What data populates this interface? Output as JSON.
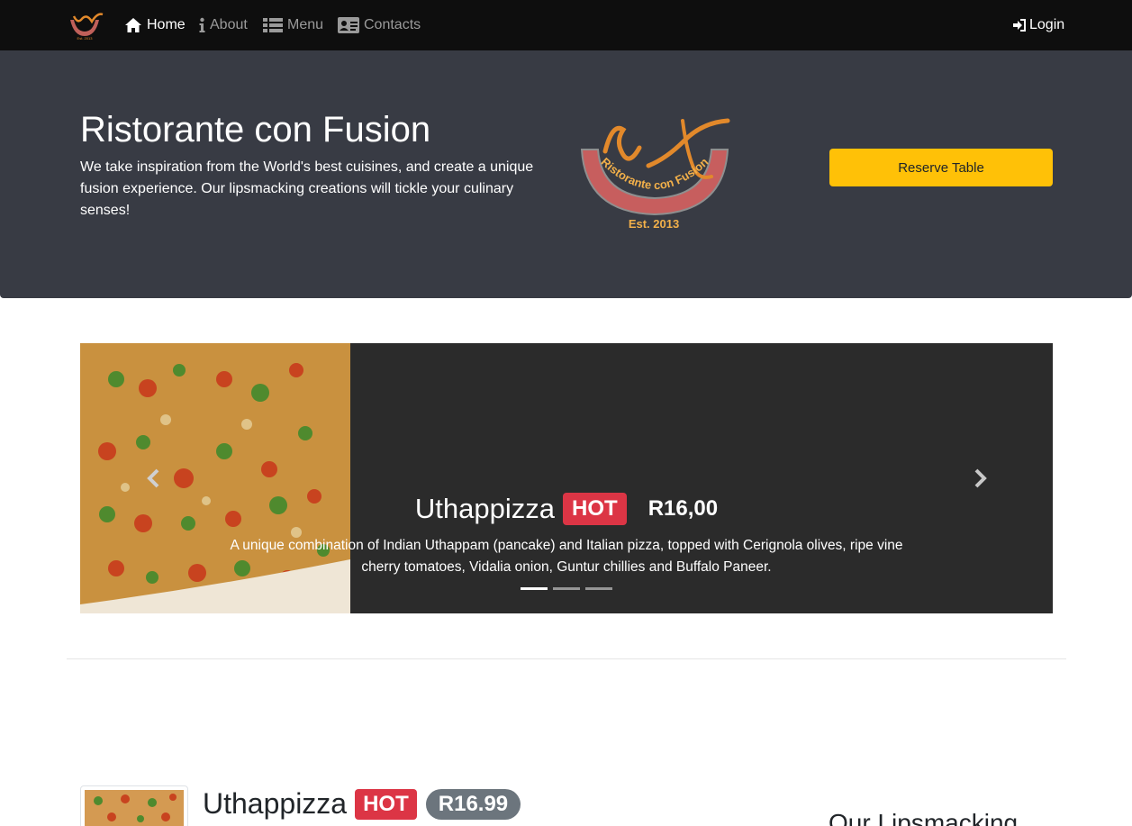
{
  "colors": {
    "navbar_bg": "#0e0e0e",
    "jumbotron_bg": "#383b44",
    "accent_warning": "#ffc107",
    "badge_danger": "#dc3545",
    "badge_secondary": "#6c757d",
    "carousel_bg": "#2b2b2b"
  },
  "navbar": {
    "brand_icon": "restaurant-logo-icon",
    "items": [
      {
        "label": "Home",
        "icon": "home-icon",
        "active": true
      },
      {
        "label": "About",
        "icon": "info-icon",
        "active": false
      },
      {
        "label": "Menu",
        "icon": "list-icon",
        "active": false
      },
      {
        "label": "Contacts",
        "icon": "address-card-icon",
        "active": false
      }
    ],
    "login": {
      "label": "Login",
      "icon": "sign-in-icon"
    }
  },
  "jumbotron": {
    "title": "Ristorante con Fusion",
    "text": "We take inspiration from the World's best cuisines, and create a unique fusion experience. Our lipsmacking creations will tickle your culinary senses!",
    "logo_text": "Ristorante con Fusion",
    "logo_est": "Est. 2013",
    "reserve_label": "Reserve Table"
  },
  "carousel": {
    "dish_name": "Uthappizza",
    "badge": "HOT",
    "price": "R16,00",
    "description": "A unique combination of Indian Uthappam (pancake) and Italian pizza, topped with Cerignola olives, ripe vine cherry tomatoes, Vidalia onion, Guntur chillies and Buffalo Paneer.",
    "indicator_count": 3,
    "active_indicator": 0
  },
  "featured": {
    "dish_name": "Uthappizza",
    "badge": "HOT",
    "price": "R16.99",
    "side_heading": "Our Lipsmacking"
  }
}
